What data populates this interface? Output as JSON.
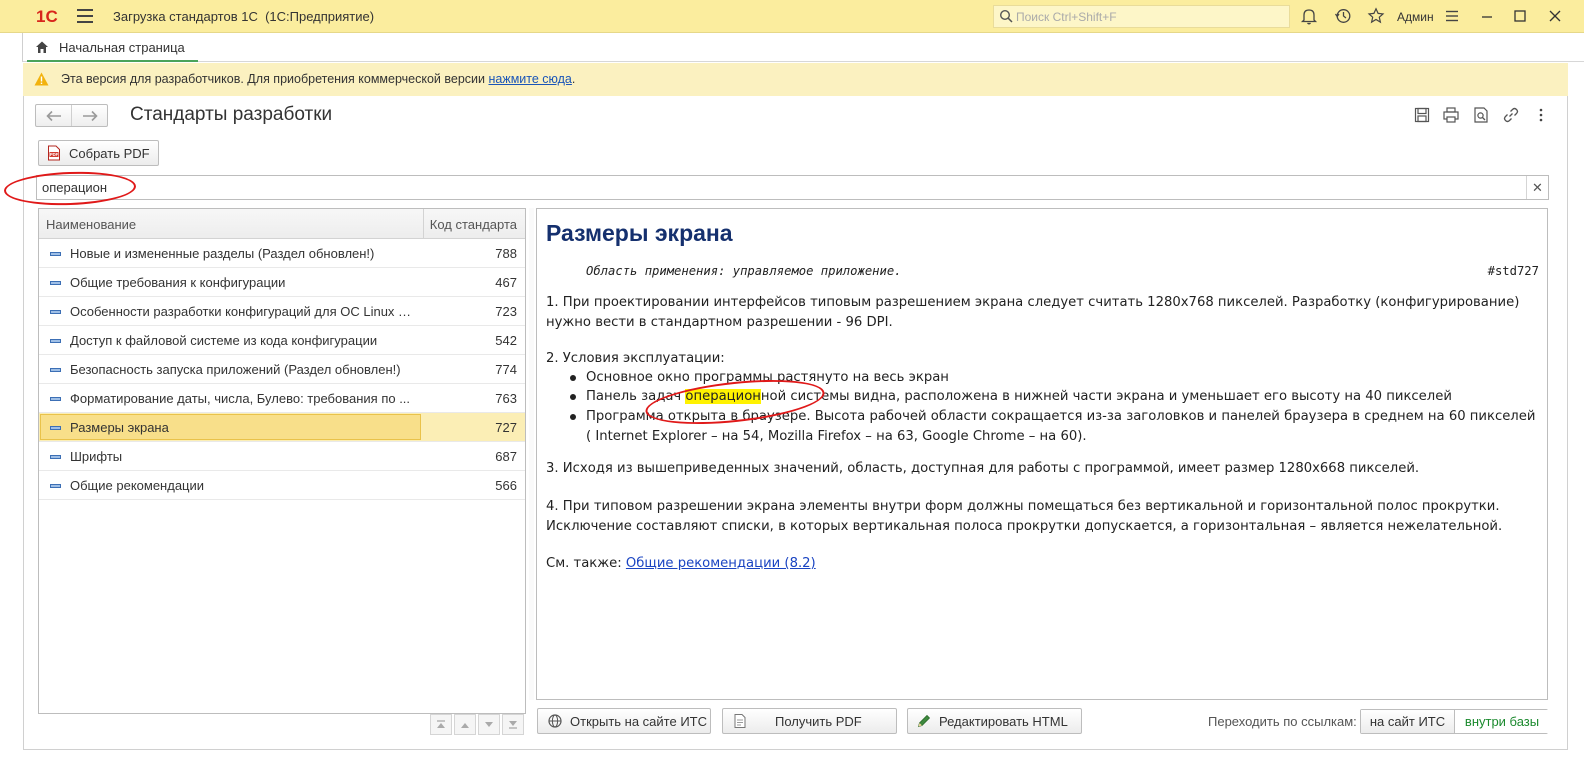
{
  "app": {
    "logo_text": "1С",
    "window_title": "Загрузка стандартов 1С",
    "window_subtitle": "(1С:Предприятие)",
    "search_placeholder": "Поиск Ctrl+Shift+F",
    "user": "Админ"
  },
  "tabs": [
    {
      "label": "Начальная страница",
      "icon": "home-icon",
      "active": true
    }
  ],
  "warning": {
    "text": "Эта версия для разработчиков. Для приобретения коммерческой версии ",
    "link": "нажмите сюда",
    "suffix": "."
  },
  "page": {
    "title": "Стандарты разработки",
    "pdf_button": "Собрать PDF",
    "filter_value": "операцион"
  },
  "list": {
    "columns": [
      "Наименование",
      "Код стандарта"
    ],
    "rows": [
      {
        "name": "Новые и измененные разделы (Раздел обновлен!)",
        "code": "788"
      },
      {
        "name": "Общие требования к конфигурации",
        "code": "467"
      },
      {
        "name": "Особенности разработки конфигураций для ОС Linux и ...",
        "code": "723"
      },
      {
        "name": "Доступ к файловой системе из кода конфигурации",
        "code": "542"
      },
      {
        "name": "Безопасность запуска приложений (Раздел обновлен!)",
        "code": "774"
      },
      {
        "name": "Форматирование даты, числа, Булево: требования по ...",
        "code": "763"
      },
      {
        "name": "Размеры экрана",
        "code": "727",
        "selected": true
      },
      {
        "name": "Шрифты",
        "code": "687"
      },
      {
        "name": "Общие рекомендации",
        "code": "566"
      }
    ]
  },
  "doc": {
    "title": "Размеры экрана",
    "scope": "Область применения: управляемое приложение.",
    "tag": "#std727",
    "p1": "1. При проектировании интерфейсов типовым разрешением экрана следует считать 1280x768 пикселей. Разработку (конфигурирование) нужно вести в стандартном разрешении - 96 DPI.",
    "p2": "2. Условия эксплуатации:",
    "li1": "Основное окно программы растянуто на весь экран",
    "li2_pre": "Панель задач ",
    "li2_hl": "операцион",
    "li2_post": "ной системы видна, расположена в нижней части экрана и уменьшает его высоту на 40 пикселей",
    "li3": "Программа открыта в браузере. Высота рабочей области сокращается из-за заголовков и панелей браузера в среднем на 60 пикселей ( Internet Explorer – на 54, Mozilla Firefox – на 63, Google Chrome – на 60).",
    "p3": "3. Исходя из вышеприведенных значений, область, доступная для работы с программой, имеет размер 1280x668 пикселей.",
    "p4": "4. При типовом разрешении экрана элементы внутри форм должны помещаться без вертикальной и горизонтальной полос прокрутки. Исключение составляют списки, в которых вертикальная полоса прокрутки допускается, а горизонтальная – является нежелательной.",
    "see_also_label": "См. также: ",
    "see_also_link": "Общие рекомендации (8.2)"
  },
  "bottom": {
    "open_its": "Открыть на сайте ИТС",
    "get_pdf": "Получить PDF",
    "edit_html": "Редактировать HTML",
    "goto_label": "Переходить по ссылкам:",
    "goto_site": "на сайт ИТС",
    "goto_inside": "внутри базы"
  },
  "colors": {
    "titlebar": "#fbed9e",
    "warning_bg": "#fbf1c0",
    "selection": "#f8df8a",
    "doc_title": "#15306e",
    "highlight": "#fff200",
    "annotation_red": "#e01919"
  }
}
